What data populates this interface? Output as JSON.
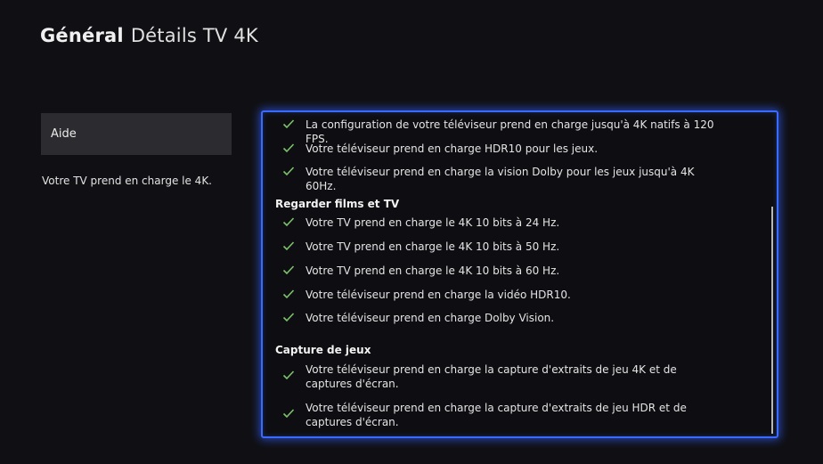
{
  "header": {
    "section": "Général",
    "page": "Détails TV 4K"
  },
  "sidebar": {
    "help_label": "Aide",
    "description": "Votre TV prend en charge le 4K."
  },
  "details": {
    "top_items": [
      "La configuration de votre téléviseur prend en charge jusqu'à 4K natifs à 120 FPS.",
      "Votre téléviseur prend en charge HDR10 pour les jeux.",
      "Votre téléviseur prend en charge la vision Dolby pour les jeux jusqu'à 4K 60Hz."
    ],
    "movies_heading": "Regarder films et TV",
    "movies_items": [
      "Votre TV prend en charge le 4K 10 bits à 24 Hz.",
      "Votre TV prend en charge le 4K 10 bits à 50 Hz.",
      "Votre TV prend en charge le 4K 10 bits à 60 Hz.",
      "Votre téléviseur prend en charge la vidéo HDR10.",
      "Votre téléviseur prend en charge Dolby Vision."
    ],
    "capture_heading": "Capture de jeux",
    "capture_items": [
      "Votre téléviseur prend en charge la capture d'extraits de jeu 4K et de captures d'écran.",
      "Votre téléviseur prend en charge la capture d'extraits de jeu HDR et de captures d'écran."
    ]
  },
  "icons": {
    "check": "check-icon"
  },
  "colors": {
    "background": "#101014",
    "focus_border": "#3a6bff",
    "check": "#7cc36b",
    "button_bg": "#2c2c30"
  }
}
